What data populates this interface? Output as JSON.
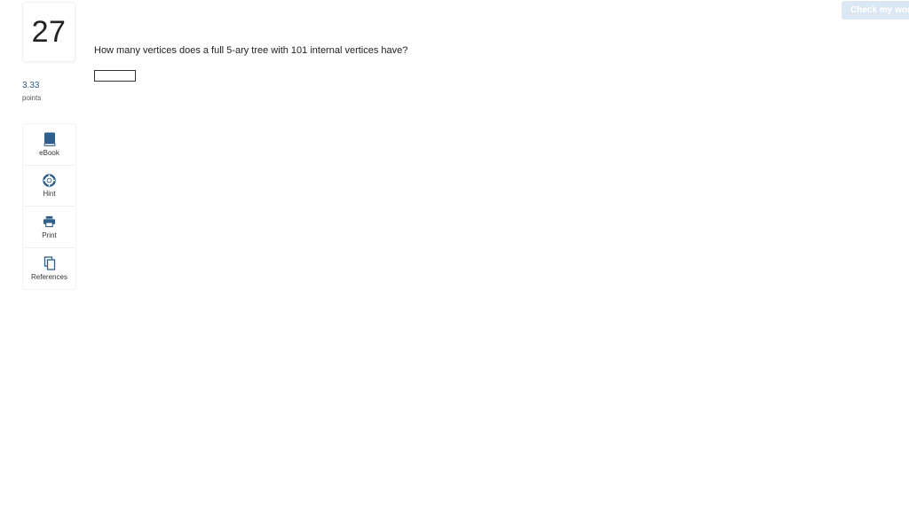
{
  "header": {
    "check_label": "Check my work"
  },
  "question": {
    "number": "27",
    "points_value": "3.33",
    "points_label": "points",
    "text": "How many vertices does a full 5-ary tree with 101 internal vertices have?",
    "answer_value": ""
  },
  "tools": [
    {
      "label": "eBook",
      "icon": "book-icon"
    },
    {
      "label": "Hint",
      "icon": "lifebuoy-icon"
    },
    {
      "label": "Print",
      "icon": "printer-icon"
    },
    {
      "label": "References",
      "icon": "copy-icon"
    }
  ],
  "colors": {
    "accent": "#2c5f8a",
    "check_button_bg": "#dbe8f4"
  }
}
